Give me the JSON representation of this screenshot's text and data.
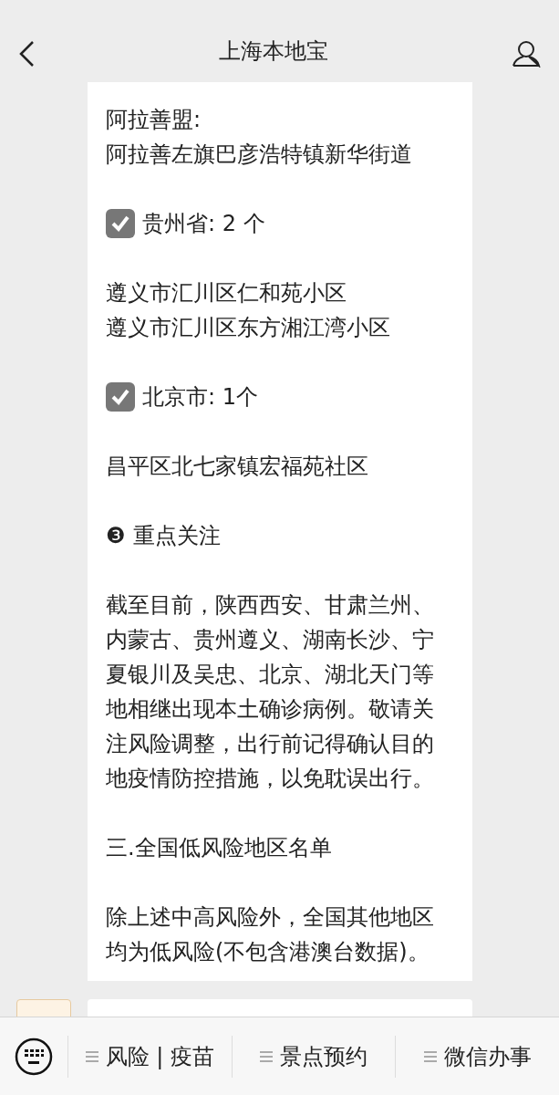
{
  "header": {
    "title": "上海本地宝"
  },
  "blocks": [
    {
      "kind": "text",
      "lines": [
        "阿拉善盟:",
        "阿拉善左旗巴彦浩特镇新华街道"
      ]
    },
    {
      "kind": "check",
      "checked": true,
      "label": "贵州省: 2 个"
    },
    {
      "kind": "text",
      "lines": [
        "遵义市汇川区仁和苑小区",
        "遵义市汇川区东方湘江湾小区"
      ]
    },
    {
      "kind": "check",
      "checked": true,
      "label": "北京市: 1个"
    },
    {
      "kind": "text",
      "lines": [
        "昌平区北七家镇宏福苑社区"
      ]
    },
    {
      "kind": "heading",
      "number": "❸",
      "label": "重点关注"
    },
    {
      "kind": "paragraph",
      "text": "截至目前，陕西西安、甘肃兰州、内蒙古、贵州遵义、湖南长沙、宁夏银川及吴忠、北京、湖北天门等地相继出现本土确诊病例。敬请关注风险调整，出行前记得确认目的地疫情防控措施，以免耽误出行。"
    },
    {
      "kind": "section",
      "label": "三.全国低风险地区名单"
    },
    {
      "kind": "paragraph",
      "text": "除上述中高风险外，全国其他地区均为低风险(不包含港澳台数据)。"
    }
  ],
  "menu": [
    "风险 | 疫苗",
    "景点预约",
    "微信办事"
  ]
}
